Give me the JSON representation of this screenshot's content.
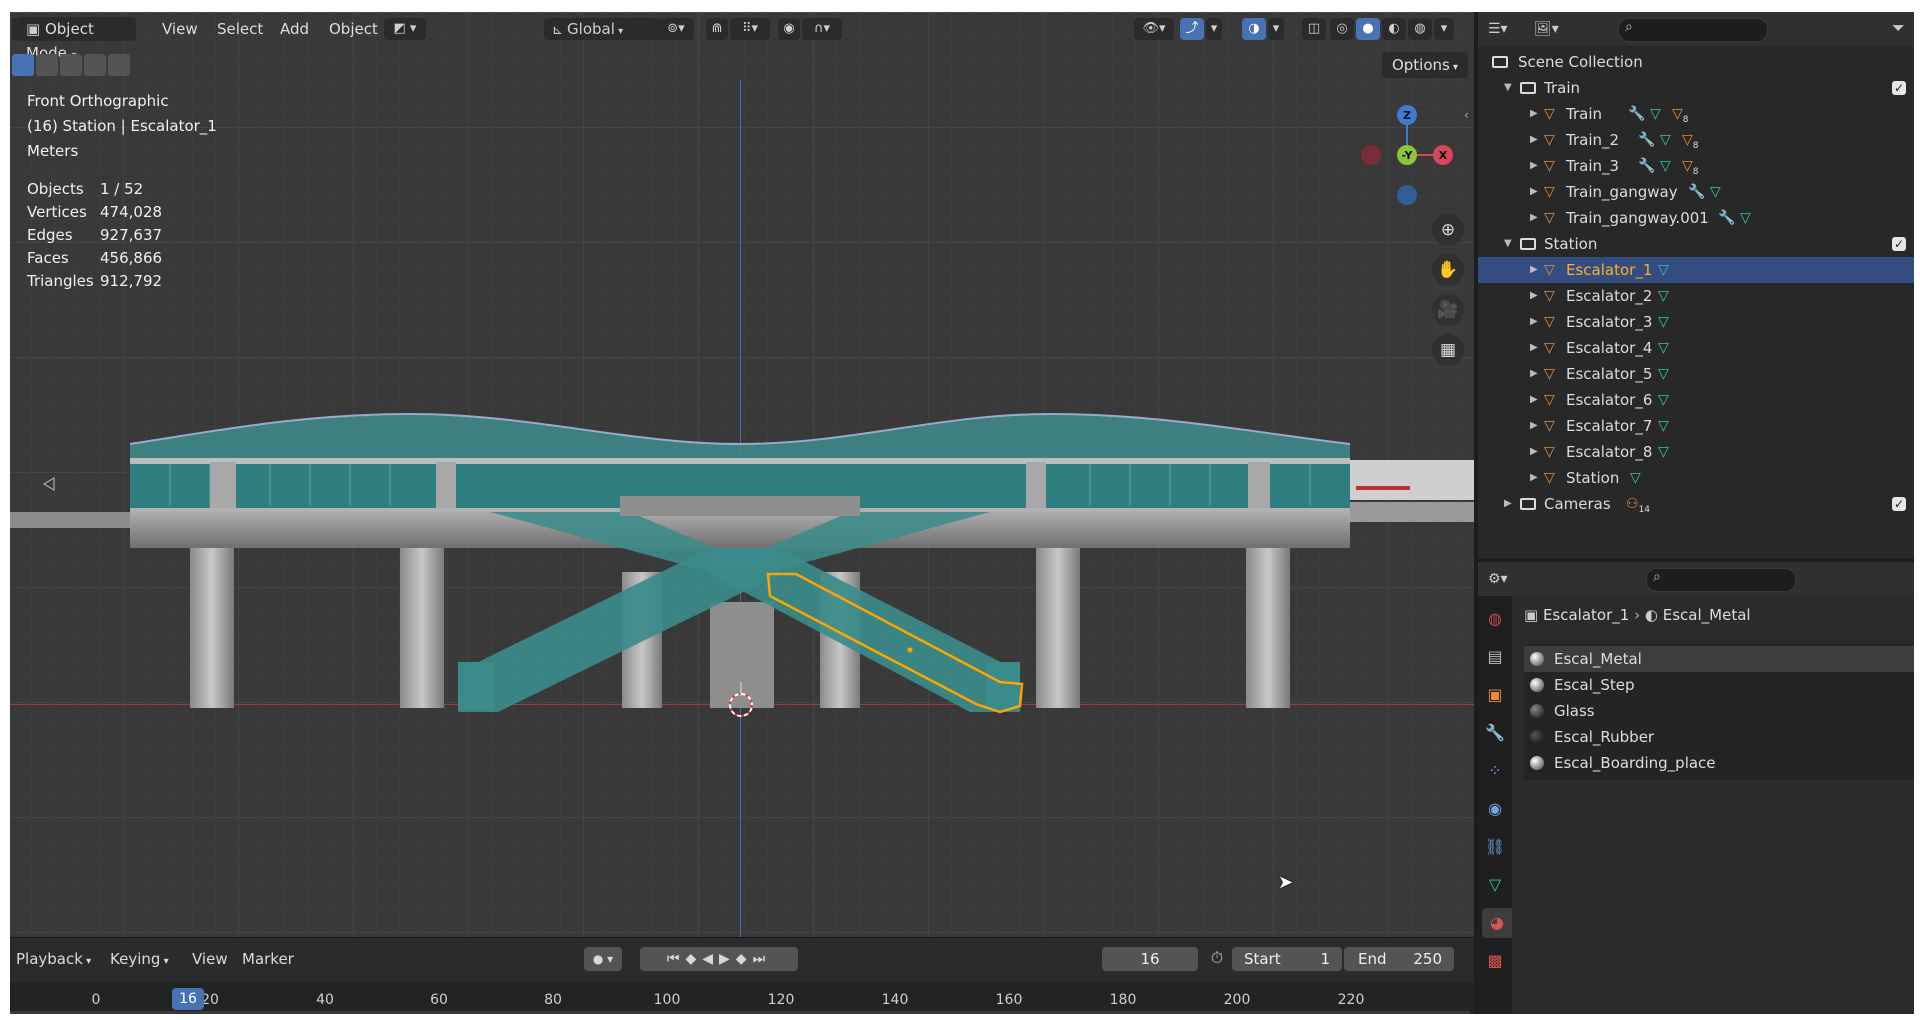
{
  "header": {
    "mode": "Object Mode",
    "menu": [
      "View",
      "Select",
      "Add",
      "Object"
    ],
    "orientation": "Global",
    "options": "Options"
  },
  "viewport_info": {
    "view_name": "Front Orthographic",
    "context": "(16) Station | Escalator_1",
    "units": "Meters",
    "stats": [
      {
        "key": "Objects",
        "value": "1 / 52"
      },
      {
        "key": "Vertices",
        "value": "474,028"
      },
      {
        "key": "Edges",
        "value": "927,637"
      },
      {
        "key": "Faces",
        "value": "456,866"
      },
      {
        "key": "Triangles",
        "value": "912,792"
      }
    ]
  },
  "gizmo": {
    "z": "Z",
    "y": "-Y",
    "x": "X"
  },
  "outliner": {
    "root": "Scene Collection",
    "rows": [
      {
        "label": "Train",
        "kind": "collection",
        "indent": 0,
        "expanded": true,
        "checked": true
      },
      {
        "label": "Train",
        "kind": "object",
        "indent": 1,
        "mods": "wrench,mesh,ob8"
      },
      {
        "label": "Train_2",
        "kind": "object",
        "indent": 1,
        "mods": "wrench,mesh,ob8"
      },
      {
        "label": "Train_3",
        "kind": "object",
        "indent": 1,
        "mods": "wrench,mesh,ob8"
      },
      {
        "label": "Train_gangway",
        "kind": "object",
        "indent": 1,
        "mods": "wrench,mesh"
      },
      {
        "label": "Train_gangway.001",
        "kind": "object",
        "indent": 1,
        "mods": "wrench,mesh"
      },
      {
        "label": "Station",
        "kind": "collection",
        "indent": 0,
        "expanded": true,
        "checked": true
      },
      {
        "label": "Escalator_1",
        "kind": "object",
        "indent": 1,
        "mods": "mesh",
        "selected": true
      },
      {
        "label": "Escalator_2",
        "kind": "object",
        "indent": 1,
        "mods": "mesh"
      },
      {
        "label": "Escalator_3",
        "kind": "object",
        "indent": 1,
        "mods": "mesh"
      },
      {
        "label": "Escalator_4",
        "kind": "object",
        "indent": 1,
        "mods": "mesh"
      },
      {
        "label": "Escalator_5",
        "kind": "object",
        "indent": 1,
        "mods": "mesh"
      },
      {
        "label": "Escalator_6",
        "kind": "object",
        "indent": 1,
        "mods": "mesh"
      },
      {
        "label": "Escalator_7",
        "kind": "object",
        "indent": 1,
        "mods": "mesh"
      },
      {
        "label": "Escalator_8",
        "kind": "object",
        "indent": 1,
        "mods": "mesh"
      },
      {
        "label": "Station",
        "kind": "object",
        "indent": 1,
        "mods": "mesh"
      },
      {
        "label": "Cameras",
        "kind": "collection",
        "indent": 0,
        "expanded": false,
        "checked": true,
        "badge": "14"
      }
    ],
    "badge_8": "8"
  },
  "properties": {
    "breadcrumb_object": "Escalator_1",
    "breadcrumb_material": "Escal_Metal",
    "materials": [
      "Escal_Metal",
      "Escal_Step",
      "Glass",
      "Escal_Rubber",
      "Escal_Boarding_place"
    ]
  },
  "timeline": {
    "menu": [
      "Playback",
      "Keying",
      "View",
      "Marker"
    ],
    "current_frame": "16",
    "start_label": "Start",
    "start_value": "1",
    "end_label": "End",
    "end_value": "250",
    "ruler_ticks": [
      "0",
      "20",
      "40",
      "60",
      "80",
      "100",
      "120",
      "140",
      "160",
      "180",
      "200",
      "220"
    ],
    "playhead": "16"
  },
  "colors": {
    "accent": "#4772b3",
    "selection_orange": "#ffaf29",
    "object_icon": "#e58d3b",
    "mesh_icon": "#34c7a5"
  }
}
